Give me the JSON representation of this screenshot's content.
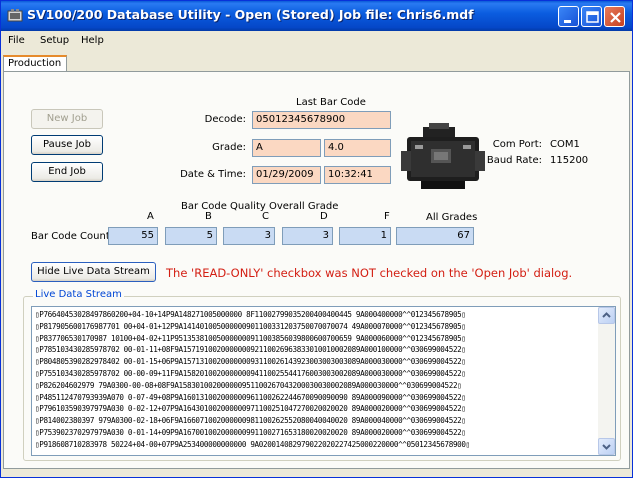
{
  "window": {
    "title": "SV100/200 Database Utility  -  Open (Stored) Job file: Chris6.mdf"
  },
  "menu": [
    "File",
    "Setup",
    "Help"
  ],
  "tabs": [
    {
      "label": "Production",
      "active": true
    }
  ],
  "buttons": {
    "new_job": "New Job",
    "pause_job": "Pause Job",
    "end_job": "End Job",
    "hide_stream": "Hide Live Data Stream"
  },
  "barcode": {
    "header": "Last Bar Code",
    "decode_label": "Decode:",
    "decode_value": "05012345678900",
    "grade_label": "Grade:",
    "grade_letter": "A",
    "grade_value": "4.0",
    "datetime_label": "Date & Time:",
    "date": "01/29/2009",
    "time": "10:32:41"
  },
  "com": {
    "port_label": "Com Port:",
    "port_value": "COM1",
    "baud_label": "Baud Rate:",
    "baud_value": "115200"
  },
  "quality": {
    "header": "Bar Code Quality Overall Grade",
    "row_label": "Bar Code Count:",
    "all_grades_label": "All Grades",
    "grades": [
      {
        "letter": "A",
        "count": "55"
      },
      {
        "letter": "B",
        "count": "5"
      },
      {
        "letter": "C",
        "count": "3"
      },
      {
        "letter": "D",
        "count": "3"
      },
      {
        "letter": "F",
        "count": "1"
      }
    ],
    "all_grades_count": "67"
  },
  "warning": "The 'READ-ONLY' checkbox was NOT checked on the 'Open Job' dialog.",
  "live_stream": {
    "title": "Live Data Stream",
    "lines": [
      "▯P766404530284978602​00+04-10+14P9A148271005000000 8F11002799035200400400445 9A000400000^^012345678905▯",
      "▯P817905600176987701 00+04-01+12P9A141401005000000901100331203750070070074 49A000070000^^012345678905▯",
      "▯P837706530170987 10100+04-02+11P951353810050000000911003856039800600700659 9A000060000^^012345678905▯",
      "▯P785103430285978702 00-01-11+08F9A157191002000000092110026963833010010002089A000100000^^030699004522▯",
      "▯P804805390282978402 00-01-15+06P9A157131002000000093110026143923003003003089A000030000^^030699004522▯",
      "▯P755103430285978702 00-00-09+11F9A158201002000000094110025544176003003002089A000030000^^030699004522▯",
      "▯P826204602979 79A0300-00-08+08F9A158301002000000951100267043200030030002089A000030000^^030699004522▯",
      "▯P485112470793939A070 0-07-49+08P9A160131002000000961100262244670090090090 89A000090000^^030699004522▯",
      "▯P796103590397979A030 0-02-12+07P9A164301002000000971100251047270020020020 89A000020000^^030699004522▯",
      "▯P814002380397 979A0300-02-18+06F9A166071002000000981100262552080040040020 89A000040000^^030699004522▯",
      "▯P753902370297979A030 0-01-14+09P9A167001002000000991100271653180020020020 89A000020000^^030699004522▯",
      "▯P918608710283978 50224+04-00+07P9A253400000000000 9A020014082979022020227425000220000^^05012345678900▯"
    ]
  },
  "colors": {
    "titlebar": "#0b5de0",
    "decode_field": "#fbd8c2",
    "count_field": "#c9dbf3",
    "warning": "#d31e12",
    "group_title": "#0046d5"
  }
}
